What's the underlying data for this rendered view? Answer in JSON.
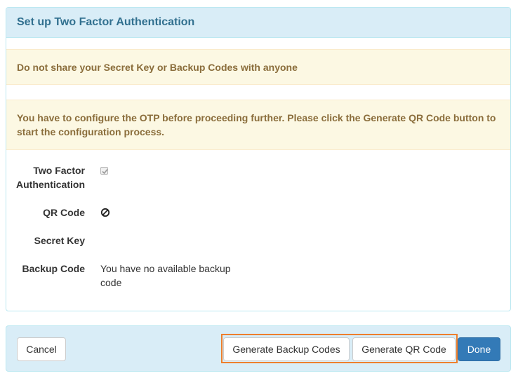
{
  "panel": {
    "title": "Set up Two Factor Authentication",
    "warning_text": "Do not share your Secret Key or Backup Codes with anyone",
    "info_text": "You have to configure the OTP before proceeding further. Please click the Generate QR Code button to start the configuration process."
  },
  "form": {
    "two_factor_label_line1": "Two Factor",
    "two_factor_label_line2": "Authentication",
    "two_factor_checked": true,
    "qr_code_label": "QR Code",
    "qr_code_icon": "ban-icon",
    "secret_key_label": "Secret Key",
    "secret_key_value": "",
    "backup_code_label": "Backup Code",
    "backup_code_value_line1": "You have no available backup",
    "backup_code_value_line2": "code"
  },
  "footer": {
    "cancel_label": "Cancel",
    "generate_backup_label": "Generate Backup Codes",
    "generate_qr_label": "Generate QR Code",
    "done_label": "Done"
  },
  "colors": {
    "primary": "#337ab7",
    "info_bg": "#d9edf7",
    "warning_bg": "#fcf8e3",
    "warning_text": "#8a6d3b",
    "highlight": "#ee7f2d"
  }
}
